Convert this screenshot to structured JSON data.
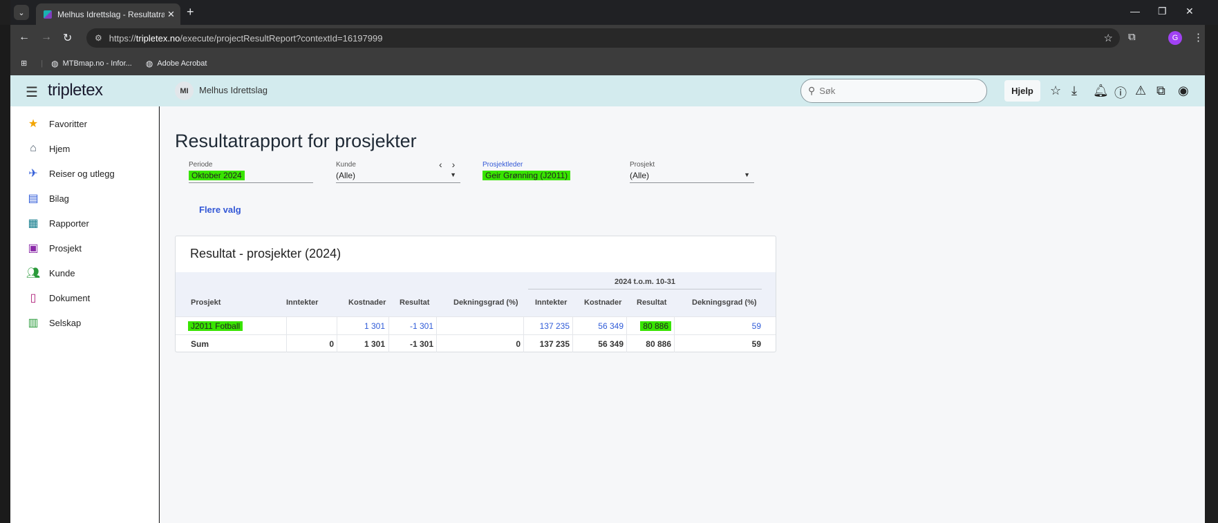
{
  "browser": {
    "tab_title": "Melhus Idrettslag - Resultatrap...",
    "url_prefix": "https://",
    "url_host": "tripletex.no",
    "url_path": "/execute/projectResultReport?contextId=16197999",
    "bookmarks": [
      {
        "label": "MTBmap.no - Infor...",
        "icon": "globe-icon"
      },
      {
        "label": "Adobe Acrobat",
        "icon": "globe-icon"
      }
    ],
    "profile_initial": "G"
  },
  "app": {
    "logo": "tripletex",
    "company_initials": "MI",
    "company_name": "Melhus Idrettslag",
    "search_placeholder": "Søk",
    "help_label": "Hjelp"
  },
  "sidebar": {
    "items": [
      {
        "label": "Favoritter",
        "icon": "star-icon",
        "color": "#f2a400"
      },
      {
        "label": "Hjem",
        "icon": "home-icon",
        "color": "#4a5a6a"
      },
      {
        "label": "Reiser og utlegg",
        "icon": "plane-icon",
        "color": "#2f5bd8"
      },
      {
        "label": "Bilag",
        "icon": "document-list-icon",
        "color": "#2f5bd8"
      },
      {
        "label": "Rapporter",
        "icon": "dashboard-icon",
        "color": "#0f7a8a"
      },
      {
        "label": "Prosjekt",
        "icon": "briefcase-icon",
        "color": "#8a2aa8"
      },
      {
        "label": "Kunde",
        "icon": "people-icon",
        "color": "#2a9a3a"
      },
      {
        "label": "Dokument",
        "icon": "file-icon",
        "color": "#b0207a"
      },
      {
        "label": "Selskap",
        "icon": "building-icon",
        "color": "#2a9a3a"
      }
    ]
  },
  "report": {
    "title": "Resultatrapport for prosjekter",
    "filters": {
      "periode": {
        "label": "Periode",
        "value": "Oktober 2024"
      },
      "kunde": {
        "label": "Kunde",
        "value": "(Alle)"
      },
      "prosjektleder": {
        "label": "Prosjektleder",
        "value": "Geir Grønning (J2011)"
      },
      "prosjekt": {
        "label": "Prosjekt",
        "value": "(Alle)"
      }
    },
    "more_options": "Flere valg",
    "card_title": "Resultat - prosjekter (2024)",
    "group_header": "2024 t.o.m. 10-31",
    "columns": [
      "Prosjekt",
      "Inntekter",
      "Kostnader",
      "Resultat",
      "Dekningsgrad (%)",
      "Inntekter",
      "Kostnader",
      "Resultat",
      "Dekningsgrad (%)"
    ],
    "rows": [
      {
        "prosjekt": "J2011 Fotball",
        "inntekter": "",
        "kostnader": "1 301",
        "resultat": "-1 301",
        "dekningsgrad": "",
        "ytd_inntekter": "137 235",
        "ytd_kostnader": "56 349",
        "ytd_resultat": "80 886",
        "ytd_dekningsgrad": "59"
      }
    ],
    "sum": {
      "prosjekt": "Sum",
      "inntekter": "0",
      "kostnader": "1 301",
      "resultat": "-1 301",
      "dekningsgrad": "0",
      "ytd_inntekter": "137 235",
      "ytd_kostnader": "56 349",
      "ytd_resultat": "80 886",
      "ytd_dekningsgrad": "59"
    }
  }
}
